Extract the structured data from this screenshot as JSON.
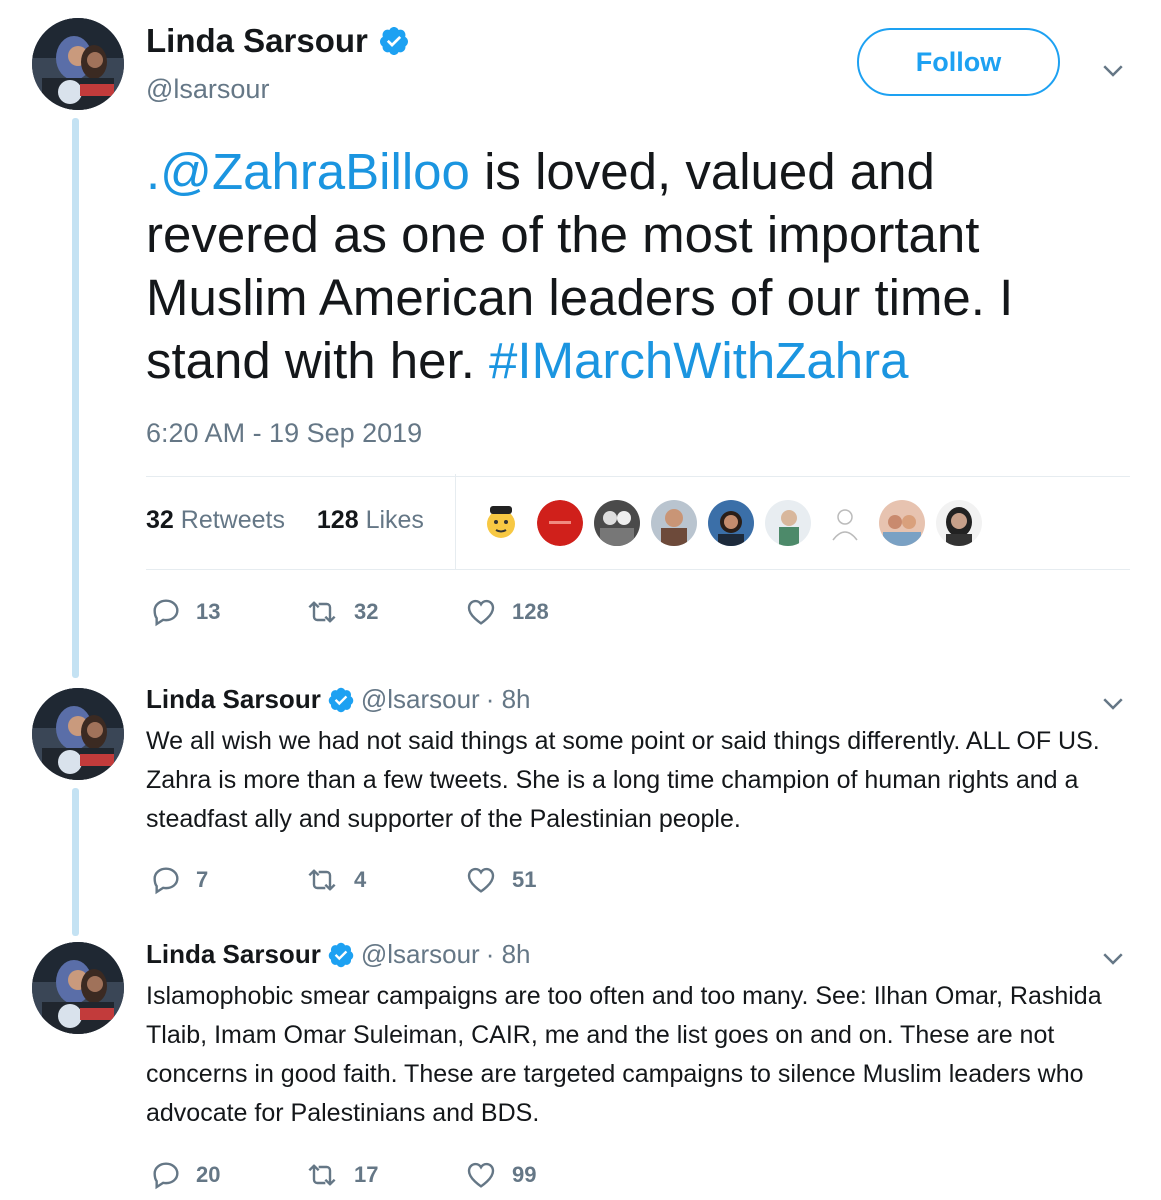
{
  "main_tweet": {
    "author_name": "Linda Sarsour",
    "handle": "@lsarsour",
    "follow_label": "Follow",
    "text_mention": ".@ZahraBilloo",
    "text_body": " is loved, valued and revered as one of the most important Muslim American leaders of our time. I stand with her. ",
    "text_hashtag": "#IMarchWithZahra",
    "timestamp": "6:20 AM - 19 Sep 2019",
    "retweets_count": "32",
    "retweets_label": "Retweets",
    "likes_count": "128",
    "likes_label": "Likes",
    "actions": {
      "replies": "13",
      "retweets": "32",
      "likes": "128"
    }
  },
  "replies": [
    {
      "author_name": "Linda Sarsour",
      "handle": "@lsarsour",
      "time": "· 8h",
      "text": "We all wish we had not said things at some point or said things differently. ALL OF US. Zahra is more than a few tweets. She is a long time champion of human rights and a steadfast ally and supporter of the Palestinian people.",
      "actions": {
        "replies": "7",
        "retweets": "4",
        "likes": "51"
      }
    },
    {
      "author_name": "Linda Sarsour",
      "handle": "@lsarsour",
      "time": "· 8h",
      "text": "Islamophobic smear campaigns are too often and too many. See: Ilhan Omar, Rashida Tlaib, Imam Omar Suleiman, CAIR, me and the list goes on and on. These are not concerns in good faith. These are targeted campaigns to silence Muslim leaders who advocate for Palestinians and BDS.",
      "actions": {
        "replies": "20",
        "retweets": "17",
        "likes": "99"
      }
    }
  ],
  "colors": {
    "link": "#1b95e0",
    "verified": "#1da1f2",
    "secondary_text": "#657786",
    "thread_line": "#c4e2f3"
  },
  "icons": [
    "verified-badge-icon",
    "chevron-down-icon",
    "reply-icon",
    "retweet-icon",
    "heart-icon"
  ]
}
